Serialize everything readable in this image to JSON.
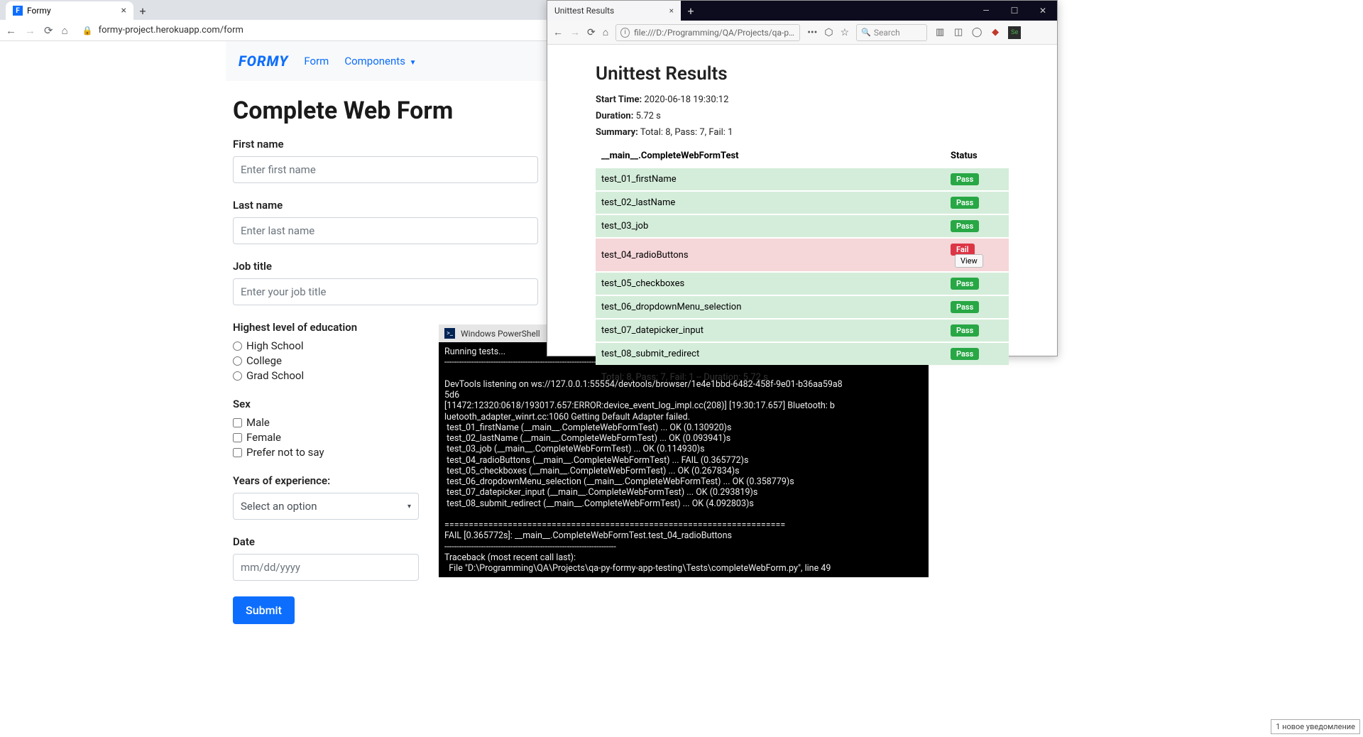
{
  "chrome": {
    "tab_title": "Formy",
    "url": "formy-project.herokuapp.com/form",
    "brand": "FORMY",
    "nav_form": "Form",
    "nav_components": "Components",
    "form": {
      "heading": "Complete Web Form",
      "first_name_label": "First name",
      "first_name_ph": "Enter first name",
      "last_name_label": "Last name",
      "last_name_ph": "Enter last name",
      "job_label": "Job title",
      "job_ph": "Enter your job title",
      "edu_label": "Highest level of education",
      "edu_options": [
        "High School",
        "College",
        "Grad School"
      ],
      "sex_label": "Sex",
      "sex_options": [
        "Male",
        "Female",
        "Prefer not to say"
      ],
      "years_label": "Years of experience:",
      "years_ph": "Select an option",
      "date_label": "Date",
      "date_ph": "mm/dd/yyyy",
      "submit": "Submit"
    }
  },
  "firefox": {
    "tab_title": "Unittest Results",
    "url": "file:///D:/Programming/QA/Projects/qa-py-forn",
    "search_ph": "Search"
  },
  "unittest": {
    "title": "Unittest Results",
    "start_time_label": "Start Time:",
    "start_time": "2020-06-18 19:30:12",
    "duration_label": "Duration:",
    "duration": "5.72 s",
    "summary_label": "Summary:",
    "summary": "Total: 8, Pass: 7, Fail: 1",
    "suite": "__main__.CompleteWebFormTest",
    "status_col": "Status",
    "rows": [
      {
        "name": "test_01_firstName",
        "status": "Pass"
      },
      {
        "name": "test_02_lastName",
        "status": "Pass"
      },
      {
        "name": "test_03_job",
        "status": "Pass"
      },
      {
        "name": "test_04_radioButtons",
        "status": "Fail"
      },
      {
        "name": "test_05_checkboxes",
        "status": "Pass"
      },
      {
        "name": "test_06_dropdownMenu_selection",
        "status": "Pass"
      },
      {
        "name": "test_07_datepicker_input",
        "status": "Pass"
      },
      {
        "name": "test_08_submit_redirect",
        "status": "Pass"
      }
    ],
    "view_btn": "View",
    "footer": "Total: 8, Pass: 7, Fail: 1 -- Duration: 5.72 s"
  },
  "powershell": {
    "title": "Windows PowerShell",
    "body": "Running tests...\n----------------------------------------------------------------------\n\nDevTools listening on ws://127.0.0.1:55554/devtools/browser/1e4e1bbd-6482-458f-9e01-b36aa59a8\n5d6\n[11472:12320:0618/193017.657:ERROR:device_event_log_impl.cc(208)] [19:30:17.657] Bluetooth: b\nluetooth_adapter_winrt.cc:1060 Getting Default Adapter failed.\n test_01_firstName (__main__.CompleteWebFormTest) ... OK (0.130920)s\n test_02_lastName (__main__.CompleteWebFormTest) ... OK (0.093941)s\n test_03_job (__main__.CompleteWebFormTest) ... OK (0.114930)s\n test_04_radioButtons (__main__.CompleteWebFormTest) ... FAIL (0.365772)s\n test_05_checkboxes (__main__.CompleteWebFormTest) ... OK (0.267834)s\n test_06_dropdownMenu_selection (__main__.CompleteWebFormTest) ... OK (0.358779)s\n test_07_datepicker_input (__main__.CompleteWebFormTest) ... OK (0.293819)s\n test_08_submit_redirect (__main__.CompleteWebFormTest) ... OK (4.092803)s\n\n======================================================================\nFAIL [0.365772s]: __main__.CompleteWebFormTest.test_04_radioButtons\n----------------------------------------------------------------------\nTraceback (most recent call last):\n  File \"D:\\Programming\\QA\\Projects\\qa-py-formy-app-testing\\Tests\\completeWebForm.py\", line 49"
  },
  "notification": "1 новое уведомление"
}
